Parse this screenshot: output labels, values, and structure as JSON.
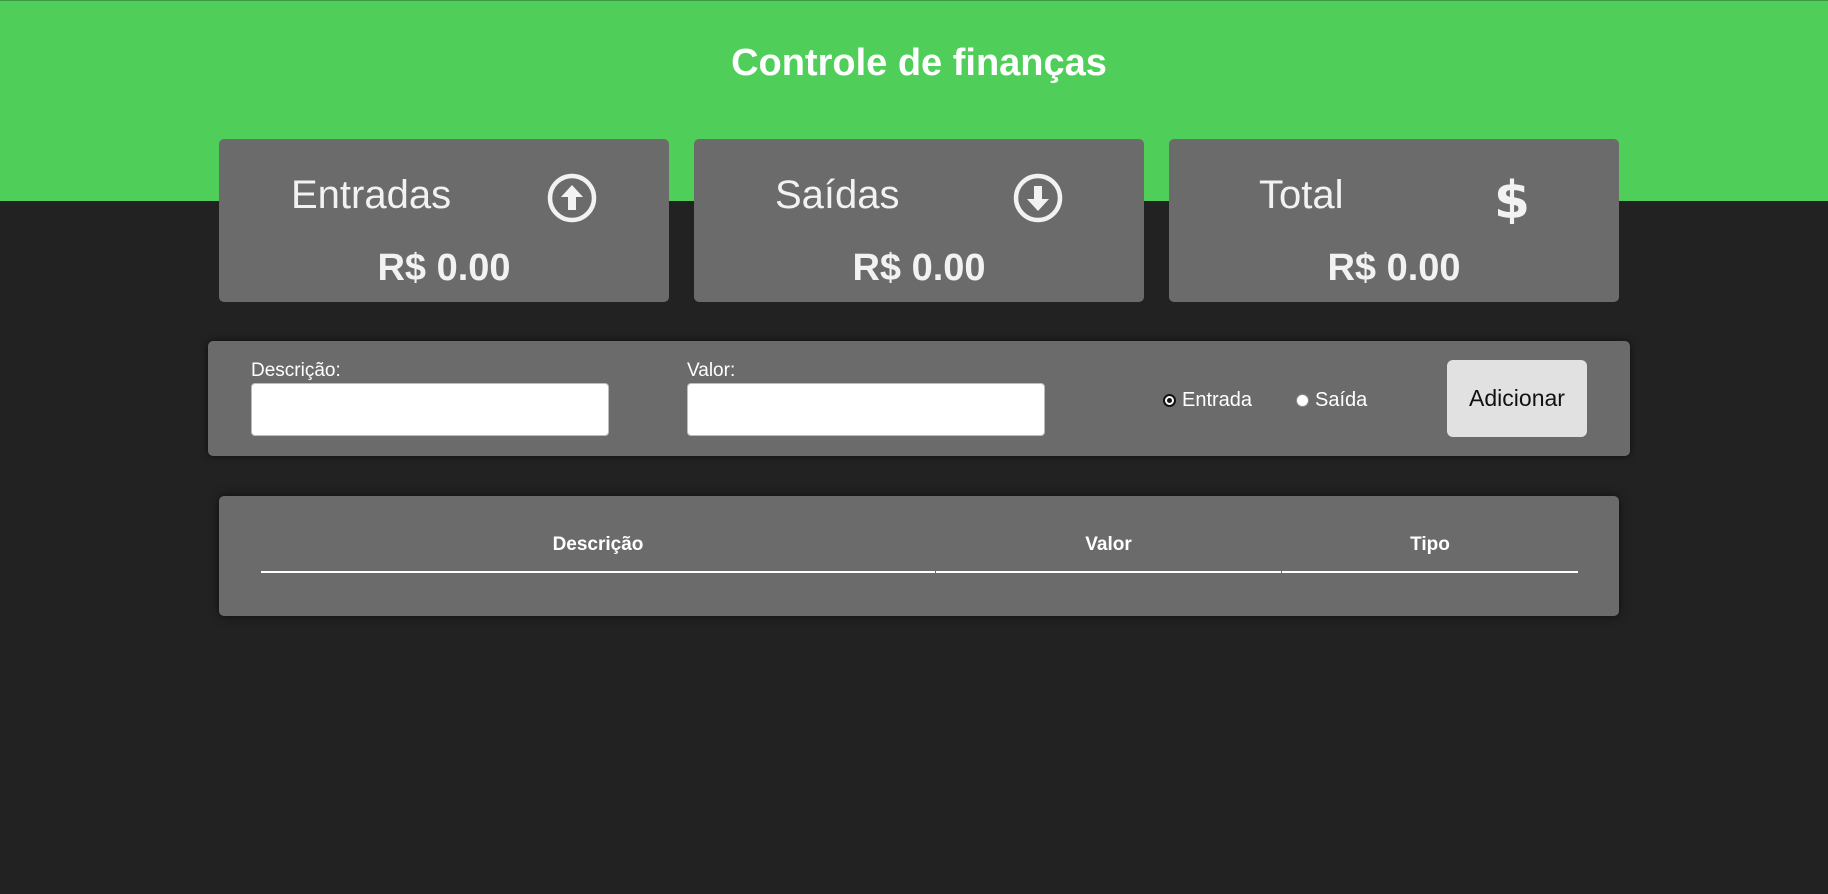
{
  "header": {
    "title": "Controle de finanças",
    "background_color": "#4fcf59"
  },
  "summary": {
    "income": {
      "label": "Entradas",
      "value": "R$ 0.00",
      "icon": "arrow-up-circle-icon"
    },
    "expense": {
      "label": "Saídas",
      "value": "R$ 0.00",
      "icon": "arrow-down-circle-icon"
    },
    "total": {
      "label": "Total",
      "value": "R$ 0.00",
      "icon": "dollar-sign-icon"
    }
  },
  "form": {
    "description_label": "Descrição:",
    "description_value": "",
    "amount_label": "Valor:",
    "amount_value": "",
    "radio_options": [
      {
        "label": "Entrada",
        "checked": true
      },
      {
        "label": "Saída",
        "checked": false
      }
    ],
    "add_button_label": "Adicionar"
  },
  "table": {
    "columns": [
      "Descrição",
      "Valor",
      "Tipo"
    ],
    "rows": []
  }
}
